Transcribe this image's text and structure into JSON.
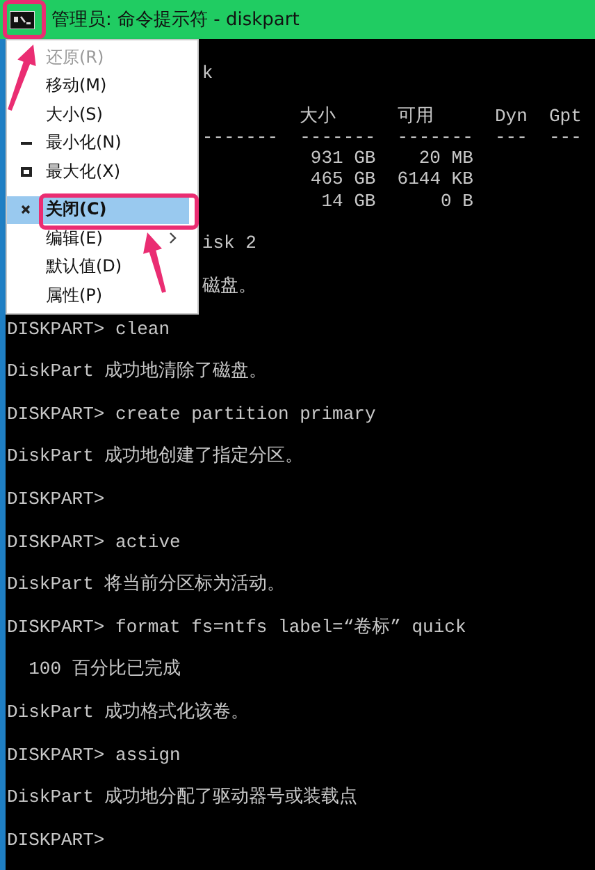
{
  "window": {
    "title": "管理员: 命令提示符 - diskpart"
  },
  "console": {
    "lines_before": [
      {
        "kind": "covered",
        "text": "k"
      },
      {
        "kind": "blank"
      }
    ],
    "table": {
      "header": [
        "大小",
        "可用",
        "Dyn",
        "Gpt"
      ],
      "rules": [
        "-------",
        "-------",
        "-------",
        "---",
        "---"
      ],
      "rows": [
        [
          "931 GB",
          "20 MB"
        ],
        [
          "465 GB",
          "6144 KB"
        ],
        [
          "14 GB",
          "0 B"
        ]
      ]
    },
    "lines": [
      {
        "kind": "blank"
      },
      {
        "kind": "covered",
        "text": "isk 2"
      },
      {
        "kind": "blank"
      },
      {
        "kind": "covered",
        "text": "磁盘。"
      },
      {
        "kind": "blank"
      },
      {
        "kind": "line",
        "text": "DISKPART> clean"
      },
      {
        "kind": "blank"
      },
      {
        "kind": "line",
        "text": "DiskPart 成功地清除了磁盘。"
      },
      {
        "kind": "blank"
      },
      {
        "kind": "line",
        "text": "DISKPART> create partition primary"
      },
      {
        "kind": "blank"
      },
      {
        "kind": "line",
        "text": "DiskPart 成功地创建了指定分区。"
      },
      {
        "kind": "blank"
      },
      {
        "kind": "line",
        "text": "DISKPART>"
      },
      {
        "kind": "blank"
      },
      {
        "kind": "line",
        "text": "DISKPART> active"
      },
      {
        "kind": "blank"
      },
      {
        "kind": "line",
        "text": "DiskPart 将当前分区标为活动。"
      },
      {
        "kind": "blank"
      },
      {
        "kind": "line",
        "text": "DISKPART> format fs=ntfs label=“卷标” quick"
      },
      {
        "kind": "blank"
      },
      {
        "kind": "line",
        "text": "  100 百分比已完成"
      },
      {
        "kind": "blank"
      },
      {
        "kind": "line",
        "text": "DiskPart 成功格式化该卷。"
      },
      {
        "kind": "blank"
      },
      {
        "kind": "line",
        "text": "DISKPART> assign"
      },
      {
        "kind": "blank"
      },
      {
        "kind": "line",
        "text": "DiskPart 成功地分配了驱动器号或装载点"
      },
      {
        "kind": "blank"
      },
      {
        "kind": "line",
        "text": "DISKPART>"
      }
    ]
  },
  "menu": {
    "items": [
      {
        "kind": "item",
        "label": "还原(R)",
        "disabled": true,
        "selected": false,
        "submenu": false
      },
      {
        "kind": "item",
        "label": "移动(M)",
        "disabled": false,
        "selected": false,
        "submenu": false
      },
      {
        "kind": "item",
        "label": "大小(S)",
        "disabled": false,
        "selected": false,
        "submenu": false
      },
      {
        "kind": "minimize",
        "label": "最小化(N)",
        "disabled": false,
        "selected": false,
        "submenu": false
      },
      {
        "kind": "maximize",
        "label": "最大化(X)",
        "disabled": false,
        "selected": false,
        "submenu": false
      },
      {
        "kind": "separator"
      },
      {
        "kind": "close",
        "label": "关闭(C)",
        "disabled": false,
        "selected": true,
        "submenu": false
      },
      {
        "kind": "item",
        "label": "编辑(E)",
        "disabled": false,
        "selected": false,
        "submenu": true
      },
      {
        "kind": "item",
        "label": "默认值(D)",
        "disabled": false,
        "selected": false,
        "submenu": false
      },
      {
        "kind": "item",
        "label": "属性(P)",
        "disabled": false,
        "selected": false,
        "submenu": false
      }
    ]
  },
  "callouts": [
    {
      "kind": "frame"
    },
    {
      "kind": "arrow"
    },
    {
      "kind": "frame"
    },
    {
      "kind": "arrow"
    }
  ]
}
